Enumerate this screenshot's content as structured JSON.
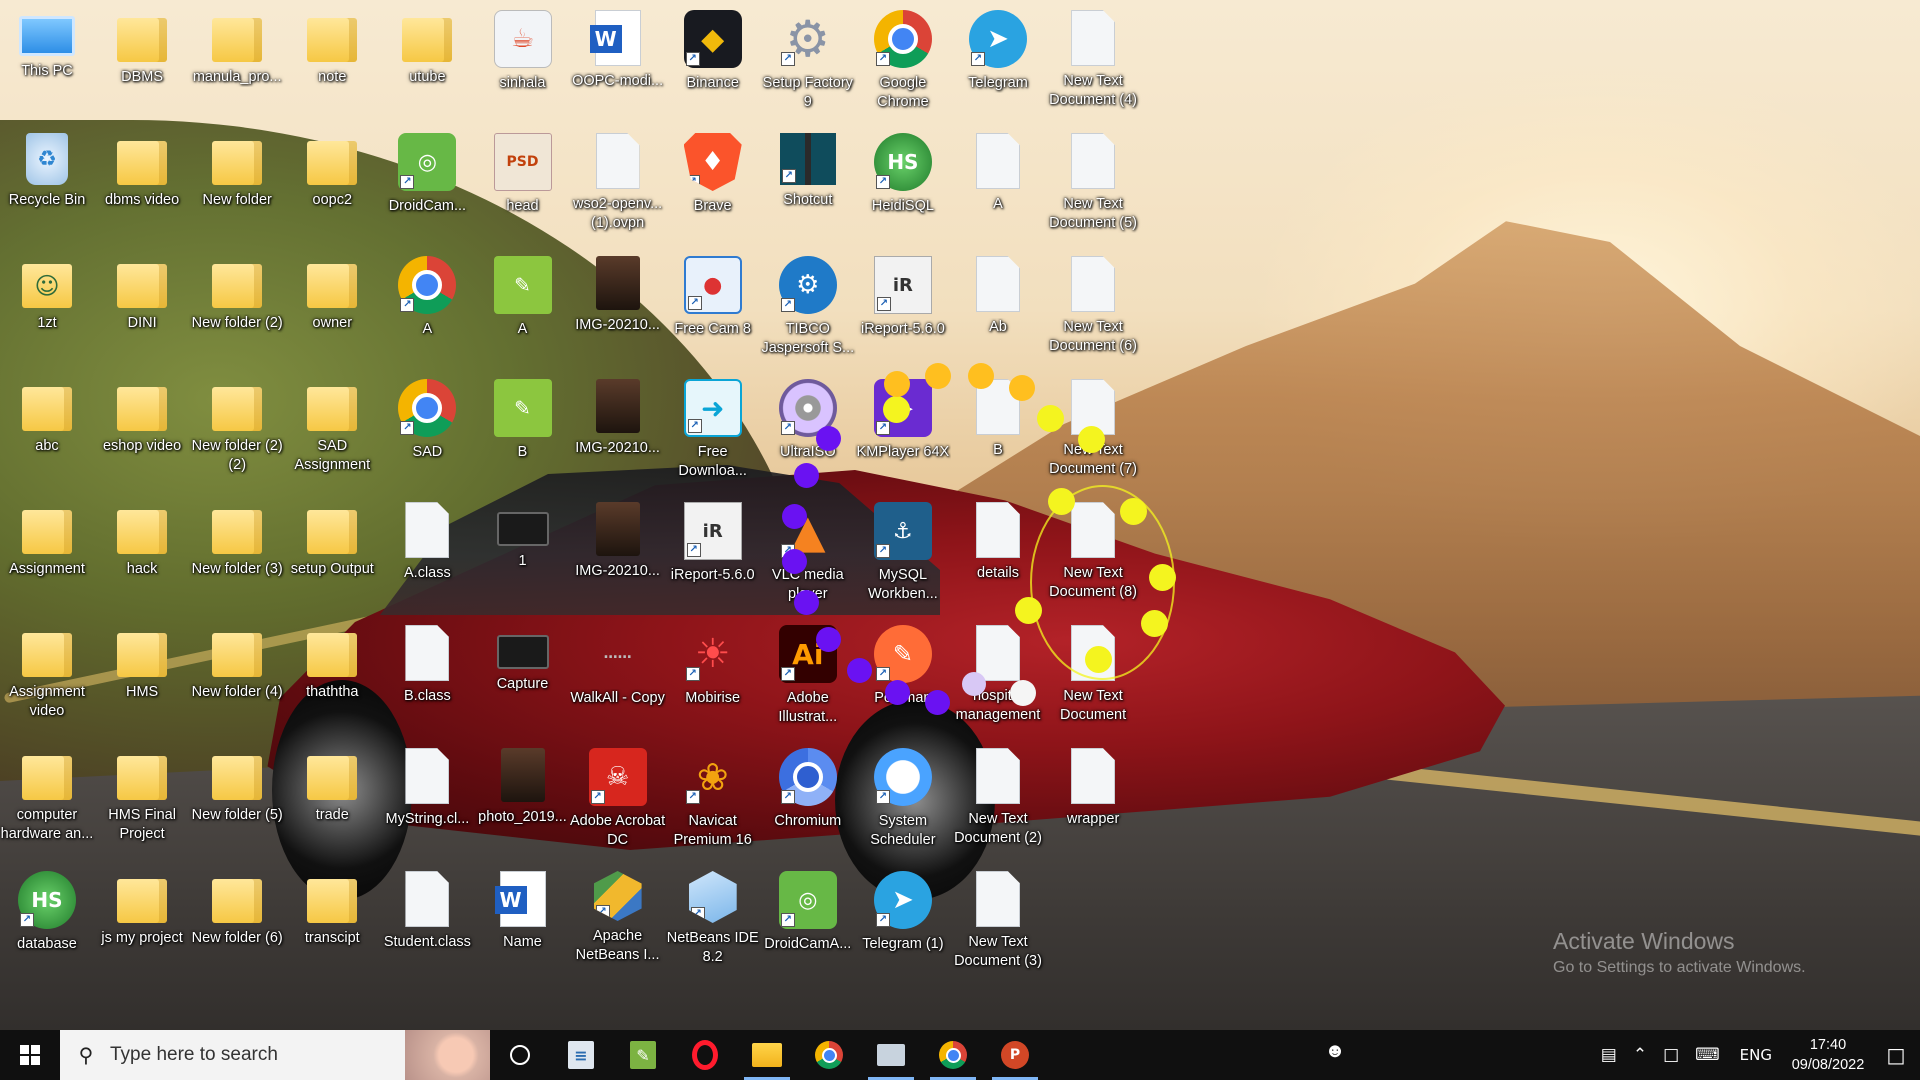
{
  "desktop": {
    "icons": [
      {
        "label": "This PC",
        "icon": "pc-icon"
      },
      {
        "label": "DBMS",
        "icon": "folder-icon"
      },
      {
        "label": "manula_pro...",
        "icon": "folder-icon"
      },
      {
        "label": "note",
        "icon": "folder-icon"
      },
      {
        "label": "utube",
        "icon": "folder-icon"
      },
      {
        "label": "sinhala",
        "icon": "java-icon"
      },
      {
        "label": "OOPC-modi...",
        "icon": "word-doc-icon"
      },
      {
        "label": "Binance",
        "icon": "binance-icon"
      },
      {
        "label": "Setup Factory 9",
        "icon": "gear-icon"
      },
      {
        "label": "Google Chrome",
        "icon": "chrome-icon"
      },
      {
        "label": "Telegram",
        "icon": "telegram-icon"
      },
      {
        "label": "New Text Document (4)",
        "icon": "text-file-icon"
      },
      {
        "label": "Recycle Bin",
        "icon": "recycle-bin-icon"
      },
      {
        "label": "dbms video",
        "icon": "folder-icon"
      },
      {
        "label": "New folder",
        "icon": "folder-icon"
      },
      {
        "label": "oopc2",
        "icon": "folder-icon"
      },
      {
        "label": "DroidCam...",
        "icon": "droidcam-icon"
      },
      {
        "label": "head",
        "icon": "psd-file-icon"
      },
      {
        "label": "wso2-openv... (1).ovpn",
        "icon": "file-icon"
      },
      {
        "label": "Brave",
        "icon": "brave-icon"
      },
      {
        "label": "Shotcut",
        "icon": "shotcut-icon"
      },
      {
        "label": "HeidiSQL",
        "icon": "heidisql-icon"
      },
      {
        "label": "A",
        "icon": "text-file-icon"
      },
      {
        "label": "New Text Document (5)",
        "icon": "text-file-icon"
      },
      {
        "label": "1zt",
        "icon": "folder-person-icon"
      },
      {
        "label": "DINI",
        "icon": "folder-icon"
      },
      {
        "label": "New folder (2)",
        "icon": "folder-icon"
      },
      {
        "label": "owner",
        "icon": "folder-icon"
      },
      {
        "label": "A",
        "icon": "chrome-icon"
      },
      {
        "label": "A",
        "icon": "jgrasp-icon"
      },
      {
        "label": "IMG-20210...",
        "icon": "photo-icon"
      },
      {
        "label": "Free Cam 8",
        "icon": "freecam-icon"
      },
      {
        "label": "TIBCO Jaspersoft S...",
        "icon": "tibco-icon"
      },
      {
        "label": "iReport-5.6.0",
        "icon": "ireport-icon"
      },
      {
        "label": "Ab",
        "icon": "text-file-icon"
      },
      {
        "label": "New Text Document (6)",
        "icon": "text-file-icon"
      },
      {
        "label": "abc",
        "icon": "folder-doc-icon"
      },
      {
        "label": "eshop video",
        "icon": "folder-icon"
      },
      {
        "label": "New folder (2) (2)",
        "icon": "folder-icon"
      },
      {
        "label": "SAD Assignment",
        "icon": "folder-icon"
      },
      {
        "label": "SAD",
        "icon": "chrome-icon"
      },
      {
        "label": "B",
        "icon": "jgrasp-icon"
      },
      {
        "label": "IMG-20210...",
        "icon": "photo-icon"
      },
      {
        "label": "Free Downloa...",
        "icon": "download-icon"
      },
      {
        "label": "UltraISO",
        "icon": "disc-icon"
      },
      {
        "label": "KMPlayer 64X",
        "icon": "kmplayer-icon"
      },
      {
        "label": "B",
        "icon": "text-file-icon"
      },
      {
        "label": "New Text Document (7)",
        "icon": "text-file-icon"
      },
      {
        "label": "Assignment",
        "icon": "folder-icon"
      },
      {
        "label": "hack",
        "icon": "folder-icon"
      },
      {
        "label": "New folder (3)",
        "icon": "folder-icon"
      },
      {
        "label": "setup Output",
        "icon": "folder-icon"
      },
      {
        "label": "A.class",
        "icon": "file-icon"
      },
      {
        "label": "1",
        "icon": "capture-icon"
      },
      {
        "label": "IMG-20210...",
        "icon": "photo-icon"
      },
      {
        "label": "iReport-5.6.0",
        "icon": "ireport-icon"
      },
      {
        "label": "VLC media player",
        "icon": "vlc-icon"
      },
      {
        "label": "MySQL Workben...",
        "icon": "mysql-icon"
      },
      {
        "label": "details",
        "icon": "text-file-icon"
      },
      {
        "label": "New Text Document (8)",
        "icon": "text-file-icon"
      },
      {
        "label": "Assignment video",
        "icon": "folder-icon"
      },
      {
        "label": "HMS",
        "icon": "folder-icon"
      },
      {
        "label": "New folder (4)",
        "icon": "folder-icon"
      },
      {
        "label": "thaththa",
        "icon": "folder-icon"
      },
      {
        "label": "B.class",
        "icon": "file-icon"
      },
      {
        "label": "Capture",
        "icon": "capture-icon"
      },
      {
        "label": "WalkAll - Copy",
        "icon": "walkall-icon"
      },
      {
        "label": "Mobirise",
        "icon": "mobirise-icon"
      },
      {
        "label": "Adobe Illustrat...",
        "icon": "illustrator-icon"
      },
      {
        "label": "Postman",
        "icon": "postman-icon"
      },
      {
        "label": "hospital management",
        "icon": "text-file-icon"
      },
      {
        "label": "New Text Document",
        "icon": "text-file-icon"
      },
      {
        "label": "computer hardware an...",
        "icon": "folder-icon"
      },
      {
        "label": "HMS Final Project",
        "icon": "folder-icon"
      },
      {
        "label": "New folder (5)",
        "icon": "folder-icon"
      },
      {
        "label": "trade",
        "icon": "folder-icon"
      },
      {
        "label": "MyString.cl...",
        "icon": "file-icon"
      },
      {
        "label": "photo_2019...",
        "icon": "photo-icon"
      },
      {
        "label": "Adobe Acrobat DC",
        "icon": "acrobat-icon"
      },
      {
        "label": "Navicat Premium 16",
        "icon": "navicat-icon"
      },
      {
        "label": "Chromium",
        "icon": "chromium-icon"
      },
      {
        "label": "System Scheduler",
        "icon": "clock-icon"
      },
      {
        "label": "New Text Document (2)",
        "icon": "text-file-icon"
      },
      {
        "label": "wrapper",
        "icon": "text-file-icon"
      },
      {
        "label": "database",
        "icon": "heidisql-icon"
      },
      {
        "label": "js my project",
        "icon": "folder-icon"
      },
      {
        "label": "New folder (6)",
        "icon": "folder-icon"
      },
      {
        "label": "transcipt",
        "icon": "folder-icon"
      },
      {
        "label": "Student.class",
        "icon": "file-icon"
      },
      {
        "label": "Name",
        "icon": "word-doc-icon"
      },
      {
        "label": "Apache NetBeans I...",
        "icon": "netbeans-cube-icon"
      },
      {
        "label": "NetBeans IDE 8.2",
        "icon": "netbeans-icon"
      },
      {
        "label": "DroidCamA...",
        "icon": "droidcam-icon"
      },
      {
        "label": "Telegram (1)",
        "icon": "telegram-icon"
      },
      {
        "label": "New Text Document (3)",
        "icon": "text-file-icon"
      }
    ]
  },
  "watermark": {
    "line1": "Activate Windows",
    "line2": "Go to Settings to activate Windows."
  },
  "taskbar": {
    "search_placeholder": "Type here to search",
    "apps": [
      "file-icon",
      "jgrasp-icon",
      "opera-icon",
      "file-explorer-icon",
      "chrome-icon",
      "monitor-icon",
      "chrome-icon",
      "powerpoint-icon"
    ],
    "powerpoint_letter": "P",
    "tray": {
      "language": "ENG",
      "time": "17:40",
      "date": "09/08/2022"
    }
  },
  "colors": {
    "taskbar_bg": "#101010",
    "search_bg": "#f3f3f3",
    "active_indicator": "#7fb6f5"
  }
}
